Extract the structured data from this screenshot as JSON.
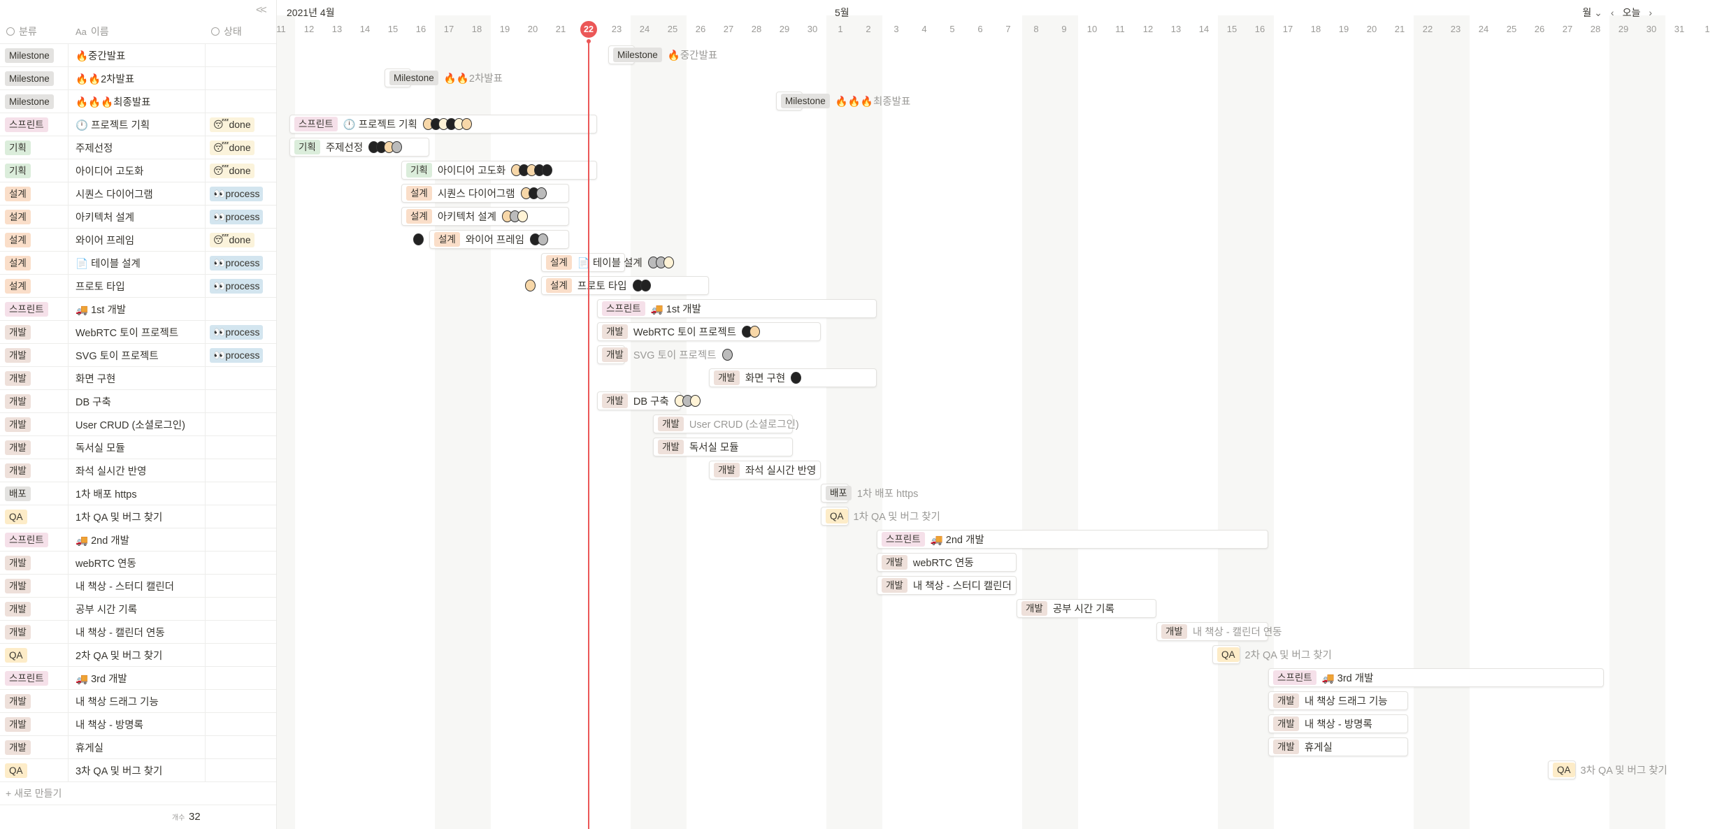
{
  "header": {
    "col_category": "분류",
    "col_name": "이름",
    "col_status": "상태",
    "name_prefix": "Aa",
    "collapse": "<<"
  },
  "rows": [
    {
      "cat": "Milestone",
      "name": "🔥중간발표",
      "status": ""
    },
    {
      "cat": "Milestone",
      "name": "🔥🔥2차발표",
      "status": ""
    },
    {
      "cat": "Milestone",
      "name": "🔥🔥🔥최종발표",
      "status": ""
    },
    {
      "cat": "스프린트",
      "name": "🕛 프로젝트 기획",
      "status": "😴done"
    },
    {
      "cat": "기획",
      "name": "주제선정",
      "status": "😴done"
    },
    {
      "cat": "기획",
      "name": "아이디어 고도화",
      "status": "😴done"
    },
    {
      "cat": "설계",
      "name": "시퀀스 다이어그램",
      "status": "👀process"
    },
    {
      "cat": "설계",
      "name": "아키텍처 설계",
      "status": "👀process"
    },
    {
      "cat": "설계",
      "name": "와이어 프레임",
      "status": "😴done"
    },
    {
      "cat": "설계",
      "name": "📄 테이블 설계",
      "status": "👀process"
    },
    {
      "cat": "설계",
      "name": "프로토 타입",
      "status": "👀process"
    },
    {
      "cat": "스프린트",
      "name": "🚚 1st 개발",
      "status": ""
    },
    {
      "cat": "개발",
      "name": "WebRTC 토이 프로젝트",
      "status": "👀process"
    },
    {
      "cat": "개발",
      "name": "SVG 토이 프로젝트",
      "status": "👀process"
    },
    {
      "cat": "개발",
      "name": "화면 구현",
      "status": ""
    },
    {
      "cat": "개발",
      "name": "DB 구축",
      "status": ""
    },
    {
      "cat": "개발",
      "name": "User CRUD (소셜로그인)",
      "status": ""
    },
    {
      "cat": "개발",
      "name": "독서실 모듈",
      "status": ""
    },
    {
      "cat": "개발",
      "name": "좌석 실시간 반영",
      "status": ""
    },
    {
      "cat": "배포",
      "name": "1차 배포 https",
      "status": ""
    },
    {
      "cat": "QA",
      "name": "1차 QA 및 버그 찾기",
      "status": ""
    },
    {
      "cat": "스프린트",
      "name": "🚚 2nd 개발",
      "status": ""
    },
    {
      "cat": "개발",
      "name": "webRTC 연동",
      "status": ""
    },
    {
      "cat": "개발",
      "name": "내 책상 - 스터디 캘린더",
      "status": ""
    },
    {
      "cat": "개발",
      "name": "공부 시간 기록",
      "status": ""
    },
    {
      "cat": "개발",
      "name": "내 책상 - 캘린더 연동",
      "status": ""
    },
    {
      "cat": "QA",
      "name": "2차 QA 및 버그 찾기",
      "status": ""
    },
    {
      "cat": "스프린트",
      "name": "🚚 3rd 개발",
      "status": ""
    },
    {
      "cat": "개발",
      "name": "내 책상 드래그 기능",
      "status": ""
    },
    {
      "cat": "개발",
      "name": "내 책상 - 방명록",
      "status": ""
    },
    {
      "cat": "개발",
      "name": "휴게실",
      "status": ""
    },
    {
      "cat": "QA",
      "name": "3차 QA 및 버그 찾기",
      "status": ""
    }
  ],
  "footer": {
    "new_label": "+ 새로 만들기",
    "count_label": "개수",
    "count_value": "32"
  },
  "category_colors": {
    "Milestone": "#e3e2e0",
    "스프린트": "#f5e0e9",
    "기획": "#dbeddb",
    "설계": "#fadec9",
    "개발": "#eee0da",
    "배포": "#e3e2e0",
    "QA": "#fdecc8"
  },
  "timeline": {
    "month_april": "2021년 4월",
    "month_may": "5월",
    "days": [
      "11",
      "12",
      "13",
      "14",
      "15",
      "16",
      "17",
      "18",
      "19",
      "20",
      "21",
      "22",
      "23",
      "24",
      "25",
      "26",
      "27",
      "28",
      "29",
      "30",
      "1",
      "2",
      "3",
      "4",
      "5",
      "6",
      "7",
      "8",
      "9",
      "10",
      "11",
      "12",
      "13",
      "14",
      "15",
      "16",
      "17",
      "18",
      "19",
      "20",
      "21",
      "22",
      "23",
      "24",
      "25",
      "26",
      "27",
      "28",
      "29",
      "30",
      "31",
      "1"
    ],
    "today": "22",
    "view_selector": "월",
    "today_button": "오늘",
    "prev_icon": "‹",
    "next_icon": "›",
    "dropdown_icon": "⌄"
  },
  "bars": [
    {
      "row": 0,
      "start": 23,
      "end": 23.95,
      "avatars": [],
      "overflow": true
    },
    {
      "row": 1,
      "start": 15,
      "end": 15.95,
      "avatars": [],
      "overflow": true
    },
    {
      "row": 2,
      "start": 29,
      "end": 29.95,
      "avatars": [],
      "overflow": true
    },
    {
      "row": 3,
      "start": 11.6,
      "end": 22.6,
      "avatars": [
        "a1",
        "a2",
        "a3",
        "a2",
        "a3",
        "a1"
      ]
    },
    {
      "row": 4,
      "start": 11.6,
      "end": 16.6,
      "avatars": [
        "a2",
        "a2",
        "a1",
        "a4"
      ]
    },
    {
      "row": 5,
      "start": 15.6,
      "end": 22.6,
      "avatars": [
        "a1",
        "a2",
        "a1",
        "a2",
        "a2"
      ]
    },
    {
      "row": 6,
      "start": 15.6,
      "end": 21.6,
      "avatars": [
        "a1",
        "a2",
        "a4"
      ]
    },
    {
      "row": 7,
      "start": 15.6,
      "end": 21.6,
      "avatars": [
        "a1",
        "a4",
        "a3"
      ]
    },
    {
      "row": 8,
      "start": 16.6,
      "end": 21.6,
      "avatars": [
        "a2",
        "a4"
      ]
    },
    {
      "row": 9,
      "start": 20.6,
      "end": 23.6,
      "avatars": [
        "a4",
        "a4",
        "a3"
      ]
    },
    {
      "row": 10,
      "start": 20.6,
      "end": 26.6,
      "avatars": [
        "a2",
        "a2"
      ]
    },
    {
      "row": 11,
      "start": 22.6,
      "end": 32.6,
      "avatars": []
    },
    {
      "row": 12,
      "start": 22.6,
      "end": 30.6,
      "avatars": [
        "a2",
        "a1"
      ]
    },
    {
      "row": 13,
      "start": 22.6,
      "end": 23.6,
      "avatars": [
        "a4"
      ],
      "overflow": true
    },
    {
      "row": 14,
      "start": 26.6,
      "end": 32.6,
      "avatars": [
        "a2"
      ]
    },
    {
      "row": 15,
      "start": 22.6,
      "end": 25.6,
      "avatars": [
        "a3",
        "a4",
        "a3"
      ]
    },
    {
      "row": 16,
      "start": 24.6,
      "end": 29.6,
      "avatars": [],
      "overflow": true
    },
    {
      "row": 17,
      "start": 24.6,
      "end": 29.6,
      "avatars": []
    },
    {
      "row": 18,
      "start": 26.6,
      "end": 30.6,
      "avatars": []
    },
    {
      "row": 19,
      "start": 30.6,
      "end": 31.6,
      "avatars": [],
      "overflow": true
    },
    {
      "row": 20,
      "start": 30.6,
      "end": 31.6,
      "avatars": [],
      "overflow": true
    },
    {
      "row": 21,
      "start": 32.6,
      "end": 46.6,
      "avatars": []
    },
    {
      "row": 22,
      "start": 32.6,
      "end": 37.6,
      "avatars": []
    },
    {
      "row": 23,
      "start": 32.6,
      "end": 37.6,
      "avatars": []
    },
    {
      "row": 24,
      "start": 37.6,
      "end": 42.6,
      "avatars": []
    },
    {
      "row": 25,
      "start": 42.6,
      "end": 46.6,
      "avatars": [],
      "overflow": true
    },
    {
      "row": 26,
      "start": 44.6,
      "end": 45.6,
      "avatars": [],
      "overflow": true
    },
    {
      "row": 27,
      "start": 46.6,
      "end": 58.6,
      "avatars": []
    },
    {
      "row": 28,
      "start": 46.6,
      "end": 51.6,
      "avatars": []
    },
    {
      "row": 29,
      "start": 46.6,
      "end": 51.6,
      "avatars": []
    },
    {
      "row": 30,
      "start": 46.6,
      "end": 51.6,
      "avatars": []
    },
    {
      "row": 31,
      "start": 56.6,
      "end": 57.6,
      "avatars": [],
      "overflow": true
    }
  ],
  "floating_avatars": [
    {
      "row": 8,
      "day": 16,
      "kind": "a2"
    },
    {
      "row": 10,
      "day": 20,
      "kind": "a1"
    }
  ]
}
